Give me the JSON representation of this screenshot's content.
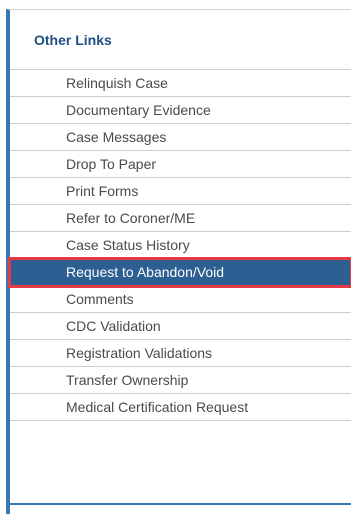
{
  "panel": {
    "title": "Other Links",
    "accent_color": "#3a78b4",
    "selected_color": "#2d5f93",
    "highlight_color": "#e53b44",
    "items": [
      {
        "label": "Relinquish Case"
      },
      {
        "label": "Documentary Evidence"
      },
      {
        "label": "Case Messages"
      },
      {
        "label": "Drop To Paper"
      },
      {
        "label": "Print Forms"
      },
      {
        "label": "Refer to Coroner/ME"
      },
      {
        "label": "Case Status History"
      },
      {
        "label": "Request to Abandon/Void",
        "selected": true
      },
      {
        "label": "Comments"
      },
      {
        "label": "CDC Validation"
      },
      {
        "label": "Registration Validations"
      },
      {
        "label": "Transfer Ownership"
      },
      {
        "label": "Medical Certification Request"
      }
    ]
  }
}
